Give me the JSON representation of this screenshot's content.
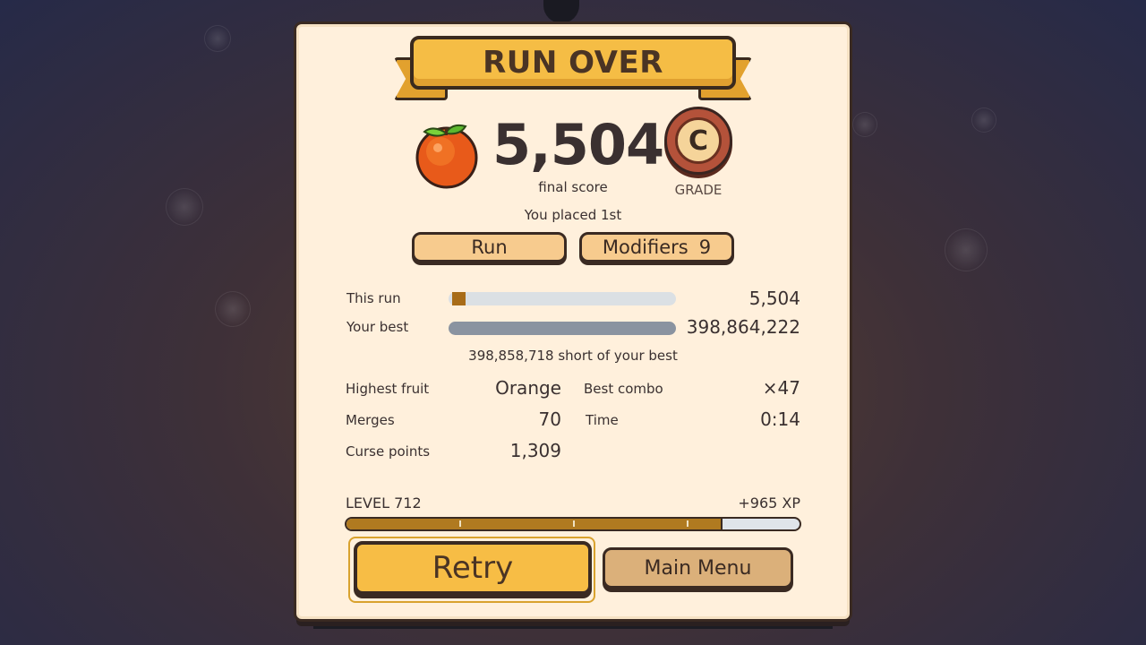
{
  "header": {
    "title": "RUN OVER"
  },
  "score": {
    "value": "5,504",
    "label": "final score",
    "fruit_icon": "orange-fruit-icon"
  },
  "grade": {
    "letter": "C",
    "label": "GRADE"
  },
  "placement": "You placed 1st",
  "tabs": [
    {
      "label": "Run"
    },
    {
      "label": "Modifiers",
      "count": "9"
    }
  ],
  "comparison": {
    "this_run": {
      "label": "This run",
      "value": "5,504",
      "fraction": 0.0138
    },
    "your_best": {
      "label": "Your best",
      "value": "398,864,222",
      "fraction": 1.0
    },
    "short_text": "398,858,718 short of your best"
  },
  "stats": {
    "highest_fruit": {
      "label": "Highest fruit",
      "value": "Orange"
    },
    "best_combo": {
      "label": "Best combo",
      "value": "×47"
    },
    "merges": {
      "label": "Merges",
      "value": "70"
    },
    "time": {
      "label": "Time",
      "value": "0:14"
    },
    "curse_points": {
      "label": "Curse points",
      "value": "1,309"
    }
  },
  "level": {
    "label": "LEVEL 712",
    "xp_gain": "+965 XP",
    "progress": 0.83
  },
  "actions": {
    "retry": "Retry",
    "main_menu": "Main Menu"
  },
  "colors": {
    "accent": "#f7bd45",
    "panel": "#fff0dc",
    "outline": "#3a2a22",
    "xp_fill": "#b07a20"
  }
}
